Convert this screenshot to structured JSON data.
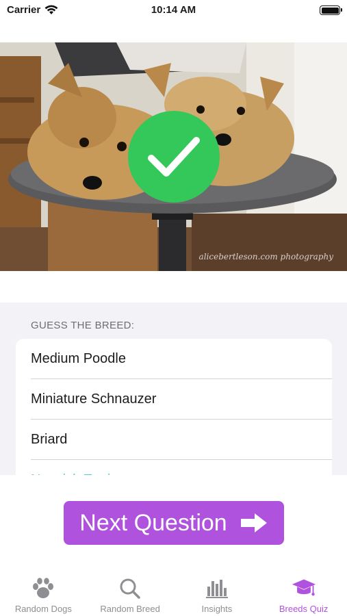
{
  "status_bar": {
    "carrier": "Carrier",
    "time": "10:14 AM",
    "battery_level": 1.0
  },
  "photo": {
    "watermark": "alicebertleson.com photography",
    "result_icon": "checkmark-icon",
    "result_color": "#34c759"
  },
  "quiz": {
    "header": "GUESS THE BREED:",
    "answers": [
      "Medium Poodle",
      "Miniature Schnauzer",
      "Briard",
      "Norwich Terrier"
    ]
  },
  "next_button": {
    "label": "Next Question",
    "icon": "arrow-right-icon",
    "color": "#af52de"
  },
  "tab_bar": {
    "tabs": [
      {
        "label": "Random Dogs",
        "icon": "paw-icon"
      },
      {
        "label": "Random Breed",
        "icon": "search-icon"
      },
      {
        "label": "Insights",
        "icon": "bar-chart-icon"
      },
      {
        "label": "Breeds Quiz",
        "icon": "graduation-cap-icon"
      }
    ],
    "active_tab": "Breeds Quiz",
    "accent_color": "#af52de"
  }
}
